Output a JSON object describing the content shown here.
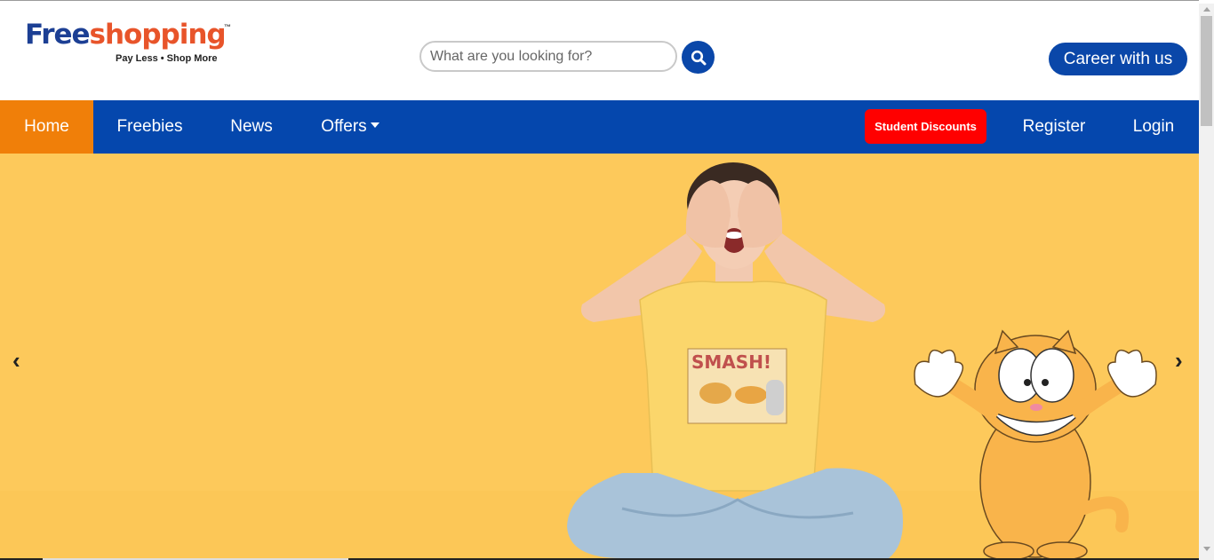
{
  "brand": {
    "name_part1": "Free",
    "name_part2": "shopping",
    "trademark": "™",
    "tagline": "Pay Less • Shop More",
    "colors": {
      "primary_blue": "#1c3f94",
      "accent_orange": "#e8542a"
    }
  },
  "search": {
    "placeholder": "What are you looking for?",
    "value": "",
    "button_icon": "search-icon"
  },
  "header": {
    "career_label": "Career with us"
  },
  "nav": {
    "home": "Home",
    "freebies": "Freebies",
    "news": "News",
    "offers": "Offers",
    "student_discounts": "Student Discounts",
    "register": "Register",
    "login": "Login",
    "active": "Home",
    "colors": {
      "bar": "#0547ad",
      "active": "#f07f09",
      "student": "#ff0000"
    }
  },
  "hero": {
    "prev_symbol": "‹",
    "next_symbol": "›",
    "shirt_text": "SMASH!",
    "background": "#fdc95b"
  }
}
